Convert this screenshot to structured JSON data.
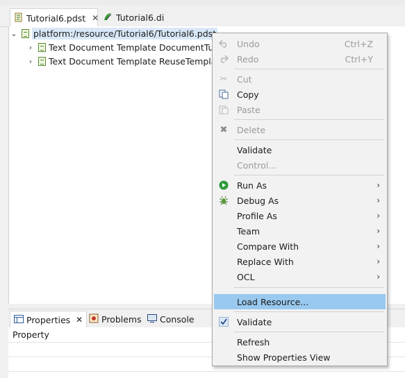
{
  "editor_tabs": [
    {
      "label": "Tutorial6.pdst",
      "icon": "pdst-file-icon",
      "active": true
    },
    {
      "label": "Tutorial6.di",
      "icon": "di-file-icon",
      "active": false
    }
  ],
  "tree": {
    "root": {
      "label": "platform:/resource/Tutorial6/Tutorial6.pdst"
    },
    "children": [
      {
        "label": "Text Document Template DocumentTuto"
      },
      {
        "label": "Text Document Template ReuseTemplate"
      }
    ]
  },
  "views": {
    "tabs": [
      {
        "label": "Properties",
        "icon": "properties-icon",
        "active": true
      },
      {
        "label": "Problems",
        "icon": "problems-icon",
        "active": false
      },
      {
        "label": "Console",
        "icon": "console-icon",
        "active": false
      }
    ],
    "column_header": "Property"
  },
  "menu": {
    "undo": {
      "label": "Undo",
      "accel": "Ctrl+Z"
    },
    "redo": {
      "label": "Redo",
      "accel": "Ctrl+Y"
    },
    "cut": {
      "label": "Cut"
    },
    "copy": {
      "label": "Copy"
    },
    "paste": {
      "label": "Paste"
    },
    "delete": {
      "label": "Delete"
    },
    "validate1": {
      "label": "Validate"
    },
    "control": {
      "label": "Control..."
    },
    "run_as": {
      "label": "Run As"
    },
    "debug_as": {
      "label": "Debug As"
    },
    "profile_as": {
      "label": "Profile As"
    },
    "team": {
      "label": "Team"
    },
    "compare_with": {
      "label": "Compare With"
    },
    "replace_with": {
      "label": "Replace With"
    },
    "ocl": {
      "label": "OCL"
    },
    "load_resource": {
      "label": "Load Resource..."
    },
    "validate2": {
      "label": "Validate"
    },
    "refresh": {
      "label": "Refresh"
    },
    "show_properties": {
      "label": "Show Properties View"
    }
  },
  "colors": {
    "menu_highlight": "#99c9ef",
    "tree_selection": "#d9e8f8",
    "run_green": "#2e9a3c"
  }
}
